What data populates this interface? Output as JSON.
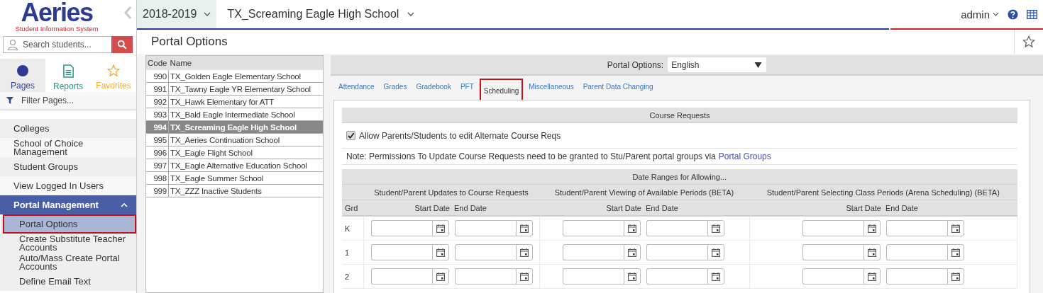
{
  "sidebar": {
    "logo": {
      "name": "Aeries",
      "tagline": "Student Information System"
    },
    "search": {
      "placeholder": "Search students..."
    },
    "tabs": [
      {
        "label": "Pages",
        "kind": "pages",
        "selected": true
      },
      {
        "label": "Reports",
        "kind": "reports",
        "selected": false
      },
      {
        "label": "Favorites",
        "kind": "favorites",
        "selected": false
      }
    ],
    "filter": {
      "placeholder": "Filter Pages..."
    },
    "items": [
      {
        "label": "Colleges",
        "selected": false
      },
      {
        "label": "School of Choice Management",
        "selected": false
      },
      {
        "label": "Student Groups",
        "selected": false
      },
      {
        "label": "View Logged In Users",
        "selected": false
      },
      {
        "label": "Portal Management",
        "expanded": true,
        "children": [
          {
            "label": "Portal Options",
            "selected": true
          },
          {
            "label": "Create Substitute Teacher Accounts",
            "selected": false
          },
          {
            "label": "Auto/Mass Create Portal Accounts",
            "selected": false
          },
          {
            "label": "Define Email Text",
            "selected": false
          }
        ]
      }
    ]
  },
  "topbar": {
    "year": "2018-2019",
    "school": "TX_Screaming Eagle High School",
    "user": "admin"
  },
  "page": {
    "title": "Portal Options"
  },
  "schools": {
    "columns": [
      "Code",
      "Name"
    ],
    "rows": [
      {
        "code": "990",
        "name": "TX_Golden Eagle Elementary School",
        "selected": false
      },
      {
        "code": "991",
        "name": "TX_Tawny Eagle YR Elementary School",
        "selected": false
      },
      {
        "code": "992",
        "name": "TX_Hawk Elementary for ATT",
        "selected": false
      },
      {
        "code": "993",
        "name": "TX_Bald Eagle Intermediate School",
        "selected": false
      },
      {
        "code": "994",
        "name": "TX_Screaming Eagle High School",
        "selected": true
      },
      {
        "code": "995",
        "name": "TX_Aeries Continuation School",
        "selected": false
      },
      {
        "code": "996",
        "name": "TX_Eagle Flight School",
        "selected": false
      },
      {
        "code": "997",
        "name": "TX_Eagle Alternative Education School",
        "selected": false
      },
      {
        "code": "998",
        "name": "TX_Eagle Summer School",
        "selected": false
      },
      {
        "code": "999",
        "name": "TX_ZZZ Inactive Students",
        "selected": false
      }
    ]
  },
  "options": {
    "label": "Portal Options:",
    "language": "English",
    "tabs": [
      {
        "label": "Attendance",
        "selected": false
      },
      {
        "label": "Grades",
        "selected": false
      },
      {
        "label": "Gradebook",
        "selected": false
      },
      {
        "label": "PFT",
        "selected": false
      },
      {
        "label": "Scheduling",
        "selected": true
      },
      {
        "label": "Miscellaneous",
        "selected": false
      },
      {
        "label": "Parent Data Changing",
        "selected": false
      }
    ]
  },
  "course_requests": {
    "title": "Course Requests",
    "allow": {
      "label": "Allow Parents/Students to edit Alternate Course Reqs",
      "checked": true
    },
    "note": {
      "text": "Note: Permissions To Update Course Requests need to be granted to Stu/Parent portal groups via",
      "link": "Portal Groups"
    }
  },
  "date_ranges": {
    "title": "Date Ranges for Allowing...",
    "grade_column": "Grd",
    "groups": [
      {
        "title": "Student/Parent Updates to Course Requests",
        "start": "Start Date",
        "end": "End Date"
      },
      {
        "title": "Student/Parent Viewing of Available Periods (BETA)",
        "start": "Start Date",
        "end": "End Date"
      },
      {
        "title": "Student/Parent Selecting Class Periods (Arena Scheduling) (BETA)",
        "start": "Start Date",
        "end": "End Date"
      }
    ],
    "rows": [
      {
        "grade": "K"
      },
      {
        "grade": "1"
      },
      {
        "grade": "2"
      }
    ]
  }
}
